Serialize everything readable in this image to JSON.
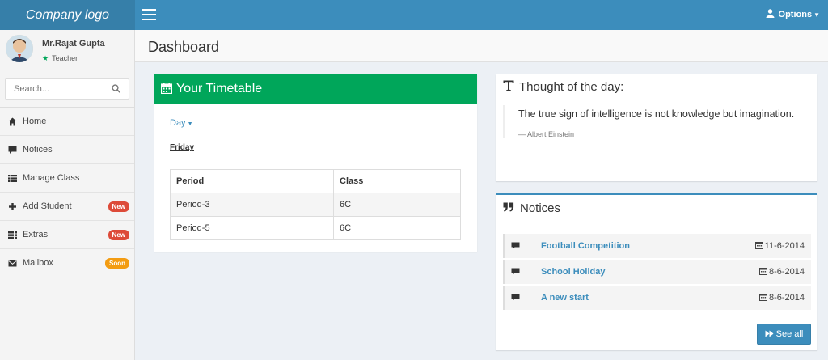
{
  "brand": {
    "logo_text": "Company logo",
    "options_label": "Options"
  },
  "user": {
    "name": "Mr.Rajat Gupta",
    "role": "Teacher"
  },
  "search": {
    "placeholder": "Search..."
  },
  "sidebar": {
    "items": [
      {
        "label": "Home",
        "icon": "home-icon"
      },
      {
        "label": "Notices",
        "icon": "comment-icon"
      },
      {
        "label": "Manage Class",
        "icon": "list-icon"
      },
      {
        "label": "Add Student",
        "icon": "plus-icon",
        "badge": "New",
        "badge_color": "#dd4b39"
      },
      {
        "label": "Extras",
        "icon": "grid-icon",
        "badge": "New",
        "badge_color": "#dd4b39"
      },
      {
        "label": "Mailbox",
        "icon": "envelope-icon",
        "badge": "Soon",
        "badge_color": "#f39c12"
      }
    ]
  },
  "page": {
    "title": "Dashboard"
  },
  "timetable": {
    "title": "Your Timetable",
    "day_selector": "Day",
    "day": "Friday",
    "columns": [
      "Period",
      "Class"
    ],
    "rows": [
      [
        "Period-3",
        "6C"
      ],
      [
        "Period-5",
        "6C"
      ]
    ]
  },
  "thought": {
    "title": "Thought of the day:",
    "quote": "The true sign of intelligence is not knowledge but imagination.",
    "author": "— Albert Einstein"
  },
  "notices": {
    "title": "Notices",
    "items": [
      {
        "title": "Football Competition",
        "date": "11-6-2014"
      },
      {
        "title": "School Holiday",
        "date": "8-6-2014"
      },
      {
        "title": "A new start",
        "date": "8-6-2014"
      }
    ],
    "see_all_label": "See all"
  },
  "colors": {
    "primary": "#3c8dbc",
    "success": "#00a65a",
    "danger": "#dd4b39",
    "warning": "#f39c12"
  }
}
